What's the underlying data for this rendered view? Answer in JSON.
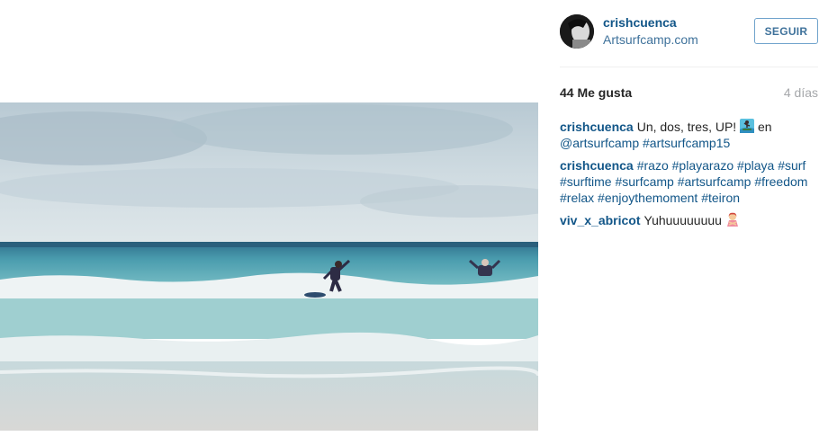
{
  "post": {
    "author": "crishcuenca",
    "location": "Artsurfcamp.com",
    "follow_label": "SEGUIR",
    "likes": "44 Me gusta",
    "time_ago": "4 días"
  },
  "comments": [
    {
      "user": "crishcuenca",
      "text1": "Un, dos, tres, UP!",
      "emoji": "surfer-emoji",
      "text2": "en",
      "mention": "@artsurfcamp",
      "hashtag": "#artsurfcamp15"
    },
    {
      "user": "crishcuenca",
      "tags": [
        "#razo",
        "#playarazo",
        "#playa",
        "#surf",
        "#surftime",
        "#surfcamp",
        "#artsurfcamp",
        "#freedom",
        "#relax",
        "#enjoythemoment",
        "#teiron"
      ]
    },
    {
      "user": "viv_x_abricot",
      "text": "Yuhuuuuuuuu",
      "emoji": "person-gesturing-emoji"
    }
  ],
  "colors": {
    "link": "#125688",
    "location": "#3f729b",
    "muted": "#a5a7aa",
    "follow_border": "#70a3cc"
  }
}
